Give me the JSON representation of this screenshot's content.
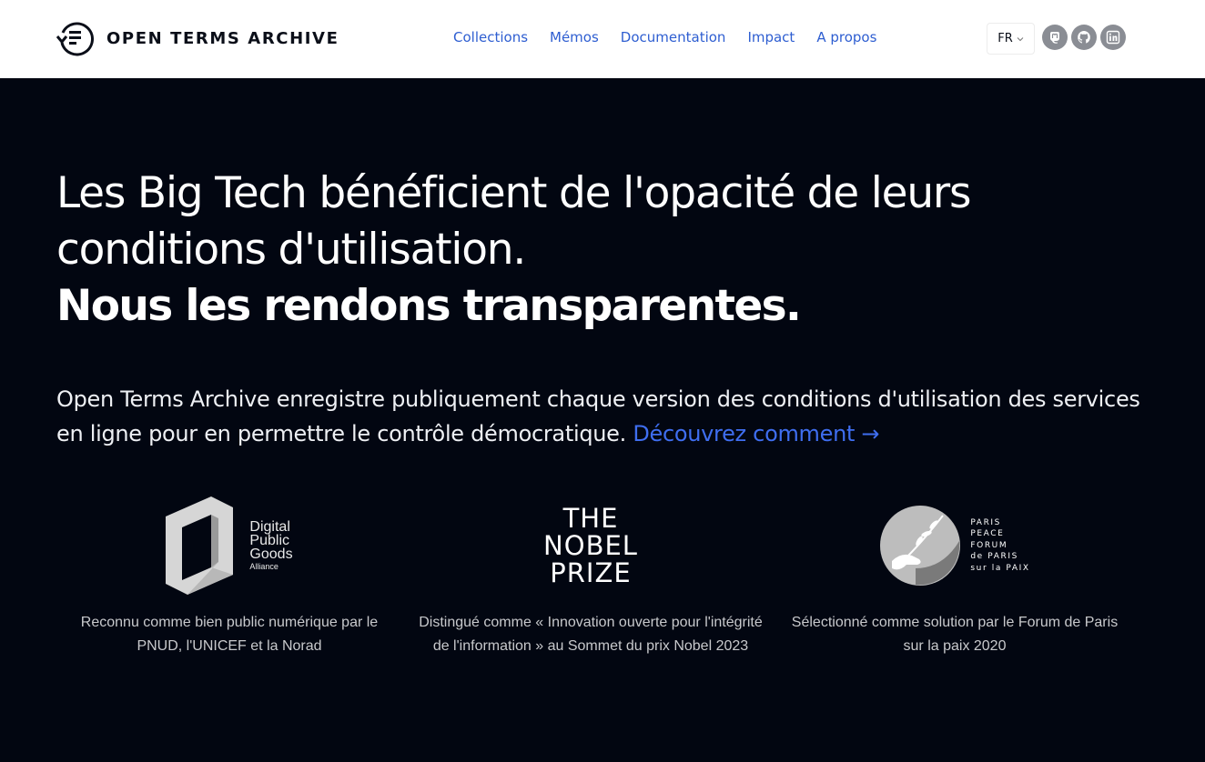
{
  "header": {
    "brand": "OPEN TERMS ARCHIVE",
    "nav": [
      {
        "label": "Collections"
      },
      {
        "label": "Mémos"
      },
      {
        "label": "Documentation"
      },
      {
        "label": "Impact"
      },
      {
        "label": "A propos"
      }
    ],
    "language": "FR",
    "socials": [
      "mastodon-icon",
      "github-icon",
      "linkedin-icon"
    ]
  },
  "hero": {
    "line1": "Les Big Tech bénéficient de l'opacité de leurs conditions d'utilisation.",
    "line2": "Nous les rendons transparentes.",
    "lead": "Open Terms Archive enregistre publiquement chaque version des conditions d'utilisation des services en ligne pour en permettre le contrôle démocratique.",
    "lead_link": "Découvrez comment →"
  },
  "awards": [
    {
      "logo_lines": [
        "Digital",
        "Public",
        "Goods",
        "Alliance"
      ],
      "caption": "Reconnu comme bien public numérique par le PNUD, l'UNICEF et la Norad"
    },
    {
      "logo_lines": [
        "THE",
        "NOBEL",
        "PRIZE"
      ],
      "caption": "Distingué comme « Innovation ouverte pour l'intégrité de l'information » au Sommet du prix Nobel 2023"
    },
    {
      "logo_lines": [
        "PARIS",
        "PEACE",
        "FORUM",
        "de PARIS",
        "sur la PAIX"
      ],
      "caption": "Sélectionné comme solution par le Forum de Paris sur la paix 2020"
    }
  ],
  "colors": {
    "background": "#020611",
    "link": "#2e5ed1",
    "lead_link": "#3f6ef0"
  }
}
